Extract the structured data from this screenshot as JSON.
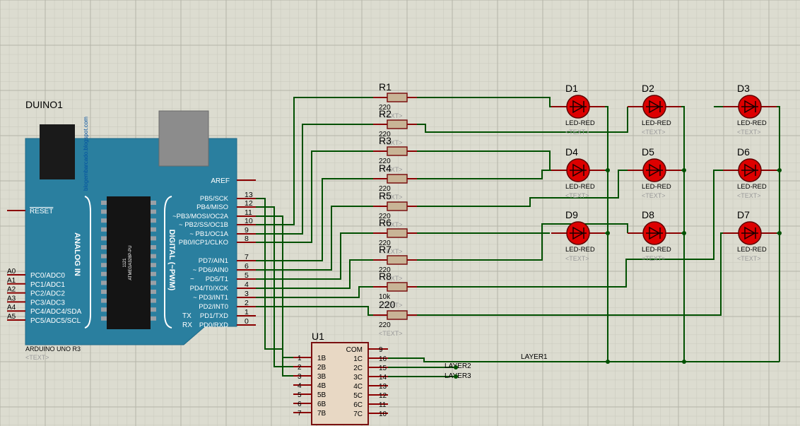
{
  "colors": {
    "background": "#dcdcd0",
    "grid_minor": "#c8c8bc",
    "grid_major": "#b4b4a8",
    "wire": "#005000",
    "pin": "#8b0000",
    "board": "#2a7f9f",
    "board_edge": "#1e6a88",
    "board_text": "#ffffff",
    "resistor_fill": "#c8b496",
    "resistor_stroke": "#7a1010",
    "led_fill": "#dd0000",
    "led_stroke": "#600000",
    "ic_fill": "#e8d8c4",
    "ic_stroke": "#7a1010",
    "label_text": "#000000",
    "ghost_text": "#9a9a9a"
  },
  "arduino": {
    "ref": "DUINO1",
    "name": "ARDUINO UNO R3",
    "placeholder": "<TEXT>",
    "aref": "AREF",
    "reset": "RESET",
    "analog_title": "ANALOG IN",
    "digital_title": "DIGITAL (~PWM)",
    "chip_text": "ATMEGA328P-PU",
    "chip_code": "1121",
    "blog": "blogembarcado.blogspot.com",
    "analog_pins": [
      {
        "ext": "A0",
        "name": "PC0/ADC0"
      },
      {
        "ext": "A1",
        "name": "PC1/ADC1"
      },
      {
        "ext": "A2",
        "name": "PC2/ADC2"
      },
      {
        "ext": "A3",
        "name": "PC3/ADC3"
      },
      {
        "ext": "A4",
        "name": "PC4/ADC4/SDA"
      },
      {
        "ext": "A5",
        "name": "PC5/ADC5/SCL"
      }
    ],
    "digital_pins": [
      {
        "num": "13",
        "name": "PB5/SCK"
      },
      {
        "num": "12",
        "name": "PB4/MISO"
      },
      {
        "num": "11",
        "name": "~PB3/MOSI/OC2A"
      },
      {
        "num": "10",
        "name": "~ PB2/SS/OC1B"
      },
      {
        "num": "9",
        "name": "~ PB1/OC1A"
      },
      {
        "num": "8",
        "name": "PB0/ICP1/CLKO"
      },
      {
        "num": "7",
        "name": "PD7/AIN1"
      },
      {
        "num": "6",
        "name": "~ PD6/AIN0"
      },
      {
        "num": "5",
        "name": "PD5/T1"
      },
      {
        "num": "4",
        "name": "PD4/T0/XCK"
      },
      {
        "num": "3",
        "name": "~ PD3/INT1"
      },
      {
        "num": "2",
        "name": "PD2/INT0"
      },
      {
        "num": "1",
        "name": "PD1/TXD"
      },
      {
        "num": "0",
        "name": "PD0/RXD"
      }
    ],
    "tx_label": "TX",
    "rx_label": "RX",
    "tilde": "~"
  },
  "resistors": [
    {
      "ref": "R1",
      "value": "220",
      "ghost": "<TEXT>"
    },
    {
      "ref": "R2",
      "value": "220",
      "ghost": "<TEXT>"
    },
    {
      "ref": "R3",
      "value": "220",
      "ghost": "<TEXT>"
    },
    {
      "ref": "R4",
      "value": "220",
      "ghost": "<TEXT>"
    },
    {
      "ref": "R5",
      "value": "220",
      "ghost": "<TEXT>"
    },
    {
      "ref": "R6",
      "value": "220",
      "ghost": "<TEXT>"
    },
    {
      "ref": "R7",
      "value": "220",
      "ghost": "<TEXT>"
    },
    {
      "ref": "R8",
      "value": "10k",
      "ghost": "<TEXT>"
    },
    {
      "ref": "220",
      "value": "220",
      "ghost": "<TEXT>"
    }
  ],
  "leds": [
    {
      "ref": "D1",
      "type": "LED-RED",
      "ghost": "<TEXT>"
    },
    {
      "ref": "D2",
      "type": "LED-RED",
      "ghost": "<TEXT>"
    },
    {
      "ref": "D3",
      "type": "LED-RED",
      "ghost": "<TEXT>"
    },
    {
      "ref": "D4",
      "type": "LED-RED",
      "ghost": "<TEXT>"
    },
    {
      "ref": "D5",
      "type": "LED-RED",
      "ghost": "<TEXT>"
    },
    {
      "ref": "D6",
      "type": "LED-RED",
      "ghost": "<TEXT>"
    },
    {
      "ref": "D9",
      "type": "LED-RED",
      "ghost": "<TEXT>"
    },
    {
      "ref": "D8",
      "type": "LED-RED",
      "ghost": "<TEXT>"
    },
    {
      "ref": "D7",
      "type": "LED-RED",
      "ghost": "<TEXT>"
    }
  ],
  "ic": {
    "ref": "U1",
    "left_pins": [
      {
        "num": "1",
        "name": "1B"
      },
      {
        "num": "2",
        "name": "2B"
      },
      {
        "num": "3",
        "name": "3B"
      },
      {
        "num": "4",
        "name": "4B"
      },
      {
        "num": "5",
        "name": "5B"
      },
      {
        "num": "6",
        "name": "6B"
      },
      {
        "num": "7",
        "name": "7B"
      }
    ],
    "right_pins": [
      {
        "num": "9",
        "name": "COM"
      },
      {
        "num": "16",
        "name": "1C"
      },
      {
        "num": "15",
        "name": "2C"
      },
      {
        "num": "14",
        "name": "3C"
      },
      {
        "num": "13",
        "name": "4C"
      },
      {
        "num": "12",
        "name": "5C"
      },
      {
        "num": "11",
        "name": "6C"
      },
      {
        "num": "10",
        "name": "7C"
      }
    ]
  },
  "net_labels": {
    "layer1": "LAYER1",
    "layer2": "LAYER2",
    "layer3": "LAYER3"
  }
}
